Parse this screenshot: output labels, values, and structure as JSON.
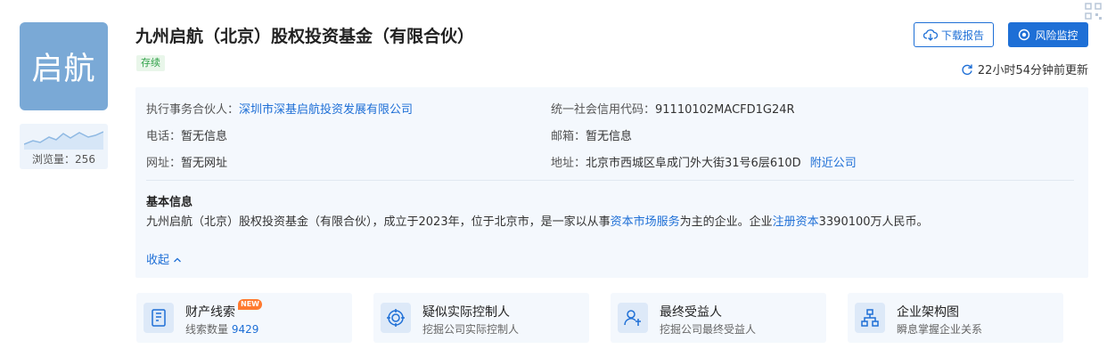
{
  "logo": {
    "text": "启航"
  },
  "views": {
    "label": "浏览量：256"
  },
  "company": {
    "name": "九州启航（北京）股权投资基金（有限合伙）",
    "status": "存续"
  },
  "actions": {
    "download": "下载报告",
    "monitor": "风险监控"
  },
  "update": {
    "text": "22小时54分钟前更新"
  },
  "info": {
    "partner_label": "执行事务合伙人：",
    "partner_value": "深圳市深基启航投资发展有限公司",
    "credit_label": "统一社会信用代码：",
    "credit_value": "91110102MACFD1G24R",
    "phone_label": "电话：",
    "phone_value": "暂无信息",
    "email_label": "邮箱：",
    "email_value": "暂无信息",
    "website_label": "网址：",
    "website_value": "暂无网址",
    "address_label": "地址：",
    "address_value": "北京市西城区阜成门外大街31号6层610D",
    "nearby_link": "附近公司"
  },
  "basic": {
    "title": "基本信息",
    "text_part1": "九州启航（北京）股权投资基金（有限合伙），成立于2023年，位于北京市，是一家以从事",
    "link1": "资本市场服务",
    "text_part2": "为主的企业。企业",
    "link2": "注册资本",
    "text_part3": "3390100万人民币。",
    "collapse": "收起"
  },
  "cards": [
    {
      "title": "财产线索",
      "badge": "NEW",
      "subtitle_prefix": "线索数量 ",
      "subtitle_number": "9429",
      "icon": "property-clue-icon"
    },
    {
      "title": "疑似实际控制人",
      "subtitle": "挖掘公司实际控制人",
      "icon": "controller-target-icon"
    },
    {
      "title": "最终受益人",
      "subtitle": "挖掘公司最终受益人",
      "icon": "beneficiary-user-icon"
    },
    {
      "title": "企业架构图",
      "subtitle": "瞬息掌握企业关系",
      "icon": "org-chart-icon"
    }
  ],
  "colors": {
    "primary": "#1e6fd6",
    "logo_bg": "#7aa9d6",
    "status_green": "#2fa148",
    "panel_bg": "#f4f8fd",
    "badge_orange": "#ff7a2f"
  }
}
